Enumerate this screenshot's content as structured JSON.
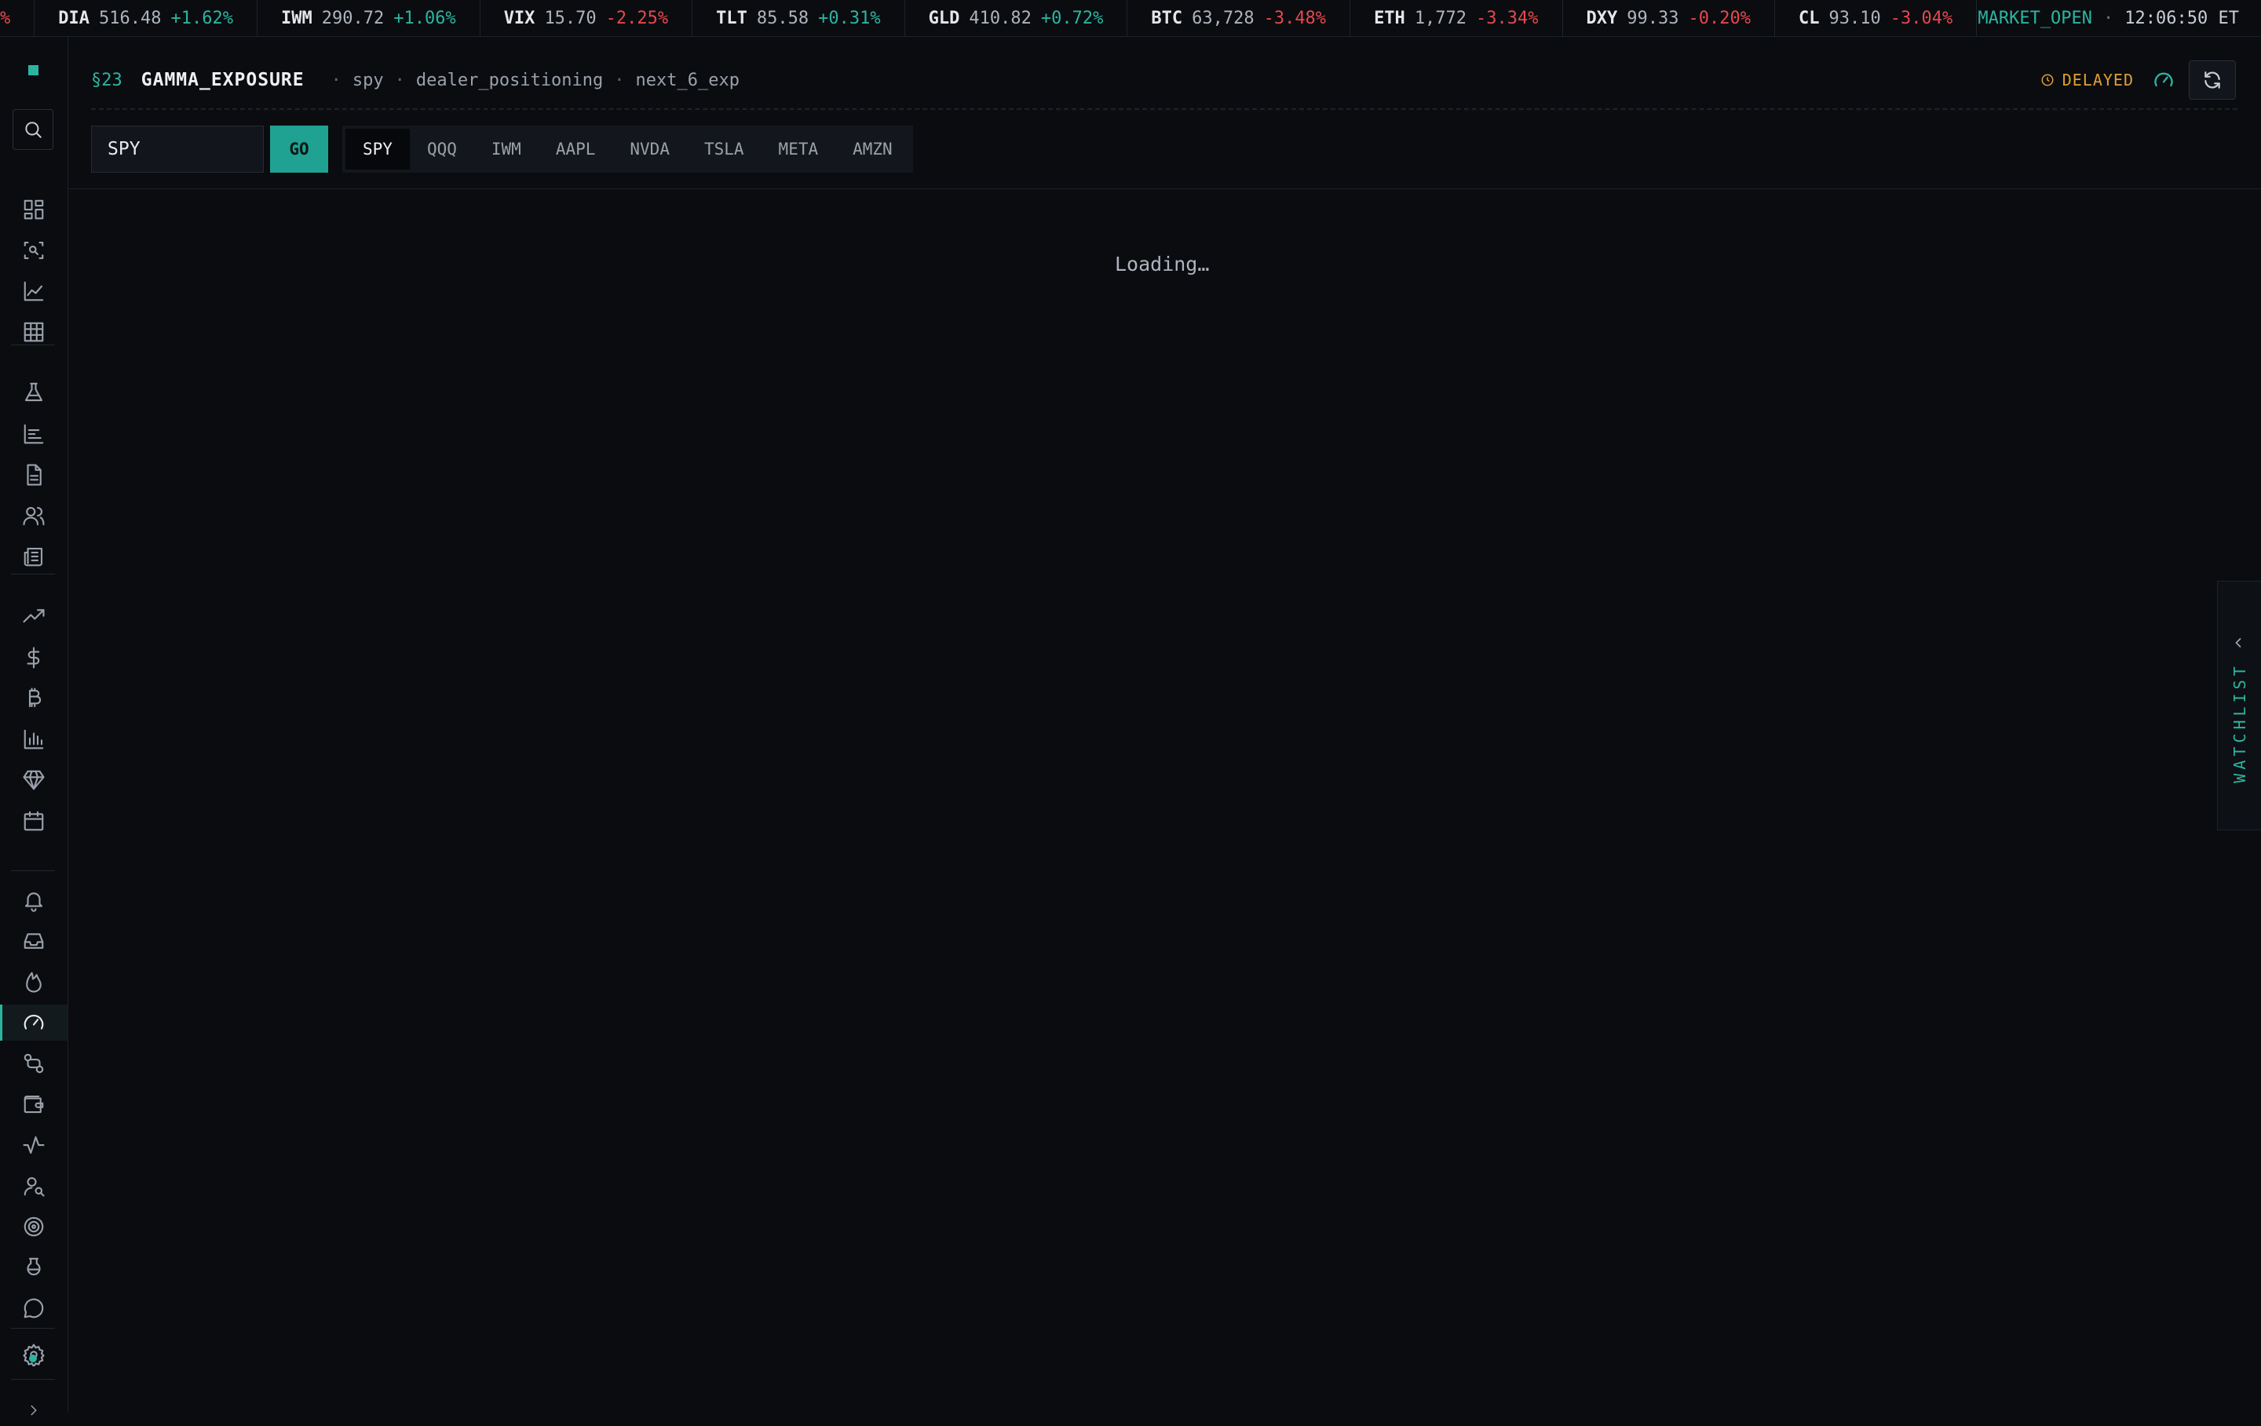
{
  "ticker": {
    "lead_fragment": "%",
    "items": [
      {
        "symbol": "DIA",
        "price": "516.48",
        "change": "+1.62%",
        "dir": "up"
      },
      {
        "symbol": "IWM",
        "price": "290.72",
        "change": "+1.06%",
        "dir": "up"
      },
      {
        "symbol": "VIX",
        "price": "15.70",
        "change": "-2.25%",
        "dir": "dn"
      },
      {
        "symbol": "TLT",
        "price": "85.58",
        "change": "+0.31%",
        "dir": "up"
      },
      {
        "symbol": "GLD",
        "price": "410.82",
        "change": "+0.72%",
        "dir": "up"
      },
      {
        "symbol": "BTC",
        "price": "63,728",
        "change": "-3.48%",
        "dir": "dn"
      },
      {
        "symbol": "ETH",
        "price": "1,772",
        "change": "-3.34%",
        "dir": "dn"
      },
      {
        "symbol": "DXY",
        "price": "99.33",
        "change": "-0.20%",
        "dir": "dn"
      },
      {
        "symbol": "CL",
        "price": "93.10",
        "change": "-3.04%",
        "dir": "dn"
      }
    ],
    "market_status": "MARKET_OPEN",
    "separator": "·",
    "time": "12:06:50 ET"
  },
  "sidebar": {
    "icons": [
      "dashboard-icon",
      "screener-icon",
      "chart-line-icon",
      "grid-table-icon",
      "flask-icon",
      "bar-list-icon",
      "document-icon",
      "users-icon",
      "newspaper-icon",
      "trending-up-icon",
      "dollar-icon",
      "bitcoin-icon",
      "bar-chart-icon",
      "gem-icon",
      "calendar-icon",
      "bell-icon",
      "inbox-icon",
      "flame-icon",
      "gauge-icon",
      "exchange-icon",
      "wallet-icon",
      "activity-icon",
      "user-search-icon",
      "target-icon",
      "beaker-icon",
      "message-icon",
      "gear-icon"
    ],
    "active": "gauge-icon"
  },
  "header": {
    "section": "§23",
    "title": "GAMMA_EXPOSURE",
    "crumbs": [
      "spy",
      "dealer_positioning",
      "next_6_exp"
    ],
    "dot": "·",
    "delayed_label": "DELAYED"
  },
  "controls": {
    "symbol_value": "SPY",
    "go_label": "GO",
    "chips": [
      "SPY",
      "QQQ",
      "IWM",
      "AAPL",
      "NVDA",
      "TSLA",
      "META",
      "AMZN"
    ],
    "active_chip": "SPY"
  },
  "main": {
    "loading_text": "Loading…"
  },
  "watchlist": {
    "label": "WATCHLIST"
  },
  "colors": {
    "accent": "#2bb5a0",
    "down": "#e5484d",
    "warning": "#e0a030",
    "background": "#0a0c10"
  }
}
